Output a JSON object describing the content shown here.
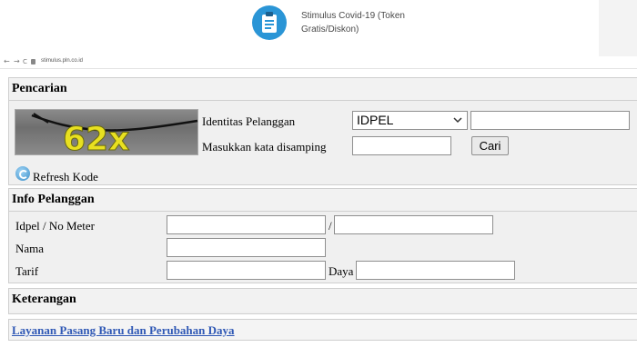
{
  "banner": {
    "app_title": "Stimulus Covid-19 (Token Gratis/Diskon)",
    "icon": "clipboard-icon",
    "accent_color": "#2a95d6"
  },
  "browser": {
    "back": "←",
    "forward": "→",
    "reload": "C",
    "url": "stimulus.pln.co.id"
  },
  "search_panel": {
    "title": "Pencarian",
    "captcha_text": "62x",
    "refresh_label": "Refresh Kode",
    "id_label": "Identitas Pelanggan",
    "id_type_selected": "IDPEL",
    "id_value": "",
    "captcha_label": "Masukkan kata disamping",
    "captcha_value": "",
    "search_button": "Cari"
  },
  "info_panel": {
    "title": "Info Pelanggan",
    "idpel_label": "Idpel / No Meter",
    "separator": "/",
    "idpel_value": "",
    "meter_value": "",
    "name_label": "Nama",
    "name_value": "",
    "tariff_label": "Tarif",
    "tariff_value": "",
    "power_label": "Daya",
    "power_value": ""
  },
  "notes_panel": {
    "title": "Keterangan"
  },
  "footer_link": {
    "label": "Layanan Pasang Baru dan Perubahan Daya"
  }
}
